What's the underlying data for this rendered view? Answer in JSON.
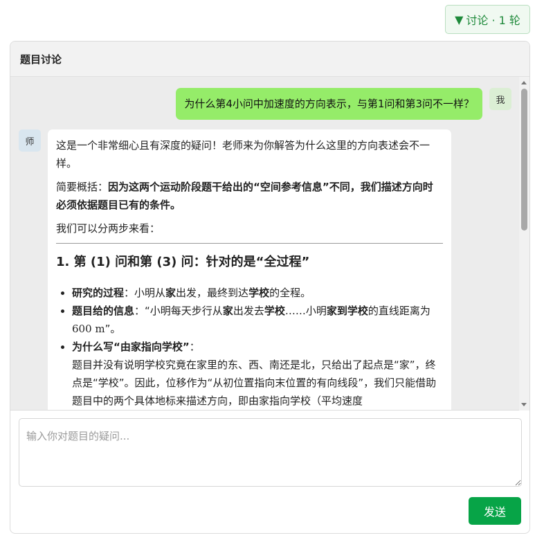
{
  "toggle": {
    "arrow": "▼",
    "label": "讨论 · 1 轮"
  },
  "panel": {
    "title": "题目讨论"
  },
  "user_message": {
    "avatar": "我",
    "text": "为什么第4小问中加速度的方向表示，与第1问和第3问不一样？"
  },
  "teacher_message": {
    "avatar": "师",
    "intro": "这是一个非常细心且有深度的疑问！老师来为你解答为什么这里的方向表述会不一样。",
    "summary_label": "简要概括：",
    "summary_bold": "因为这两个运动阶段题干给出的“空间参考信息”不同，我们描述方向时必须依据题目已有的条件。",
    "steps_intro": "我们可以分两步来看：",
    "heading1": "1. 第 (1) 问和第 (3) 问：针对的是“全过程”",
    "bullets": [
      {
        "bold": "研究的过程",
        "text1": "：小明从",
        "b2": "家",
        "text2": "出发，最终到达",
        "b3": "学校",
        "text3": "的全程。"
      },
      {
        "bold": "题目给的信息",
        "text1": "：“小明每天步行从",
        "b2": "家",
        "text2": "出发去",
        "b3": "学校",
        "text3": "……小明",
        "b4": "家到学校",
        "text4": "的直线距离为 ",
        "math": "600 m",
        "text5": "”。"
      },
      {
        "bold": "为什么写“由家指向学校”",
        "text1": "：",
        "detail": "题目并没有说明学校究竟在家里的东、西、南还是北，只给出了起点是“家”，终点是“学校”。因此，位移作为“从初位置指向末位置的有向线段”，我们只能借助题目中的两个具体地标来描述方向，即由家指向学校（平均速度"
      }
    ]
  },
  "input": {
    "placeholder": "输入你对题目的疑问..."
  },
  "send": {
    "label": "发送"
  },
  "colors": {
    "accent": "#07a447",
    "user_bubble": "#95ec69"
  }
}
